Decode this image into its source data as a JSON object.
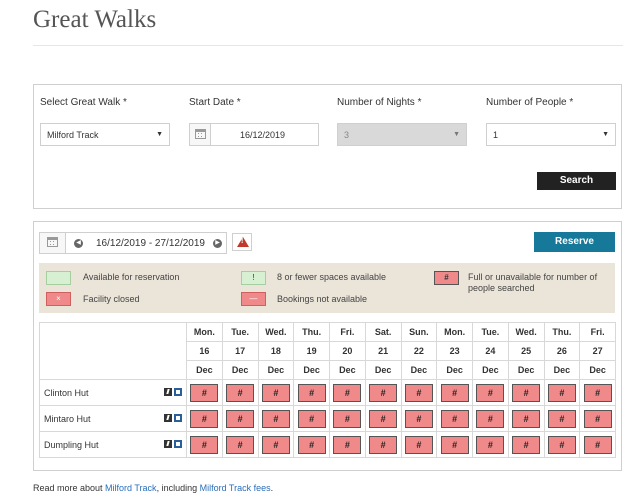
{
  "page": {
    "title": "Great Walks"
  },
  "search": {
    "walk_label": "Select Great Walk *",
    "walk_value": "Milford Track",
    "start_label": "Start Date *",
    "start_value": "16/12/2019",
    "nights_label": "Number of Nights *",
    "nights_value": "3",
    "people_label": "Number of People *",
    "people_value": "1",
    "search_button": "Search"
  },
  "results": {
    "date_range": "16/12/2019 - 27/12/2019",
    "reserve_button": "Reserve",
    "legend": {
      "available": "Available for reservation",
      "few_symbol": "!",
      "few": "8 or fewer spaces available",
      "full_symbol": "#",
      "full_line1": "Full or unavailable for number of",
      "full_line2": "people searched",
      "closed_symbol": "×",
      "closed": "Facility closed",
      "na_symbol": "—",
      "na": "Bookings not available"
    },
    "days": [
      {
        "dow": "Mon.",
        "num": "16",
        "mon": "Dec"
      },
      {
        "dow": "Tue.",
        "num": "17",
        "mon": "Dec"
      },
      {
        "dow": "Wed.",
        "num": "18",
        "mon": "Dec"
      },
      {
        "dow": "Thu.",
        "num": "19",
        "mon": "Dec"
      },
      {
        "dow": "Fri.",
        "num": "20",
        "mon": "Dec"
      },
      {
        "dow": "Sat.",
        "num": "21",
        "mon": "Dec"
      },
      {
        "dow": "Sun.",
        "num": "22",
        "mon": "Dec"
      },
      {
        "dow": "Mon.",
        "num": "23",
        "mon": "Dec"
      },
      {
        "dow": "Tue.",
        "num": "24",
        "mon": "Dec"
      },
      {
        "dow": "Wed.",
        "num": "25",
        "mon": "Dec"
      },
      {
        "dow": "Thu.",
        "num": "26",
        "mon": "Dec"
      },
      {
        "dow": "Fri.",
        "num": "27",
        "mon": "Dec"
      }
    ],
    "huts": [
      {
        "name": "Clinton Hut",
        "cells": [
          "#",
          "#",
          "#",
          "#",
          "#",
          "#",
          "#",
          "#",
          "#",
          "#",
          "#",
          "#"
        ]
      },
      {
        "name": "Mintaro Hut",
        "cells": [
          "#",
          "#",
          "#",
          "#",
          "#",
          "#",
          "#",
          "#",
          "#",
          "#",
          "#",
          "#"
        ]
      },
      {
        "name": "Dumpling Hut",
        "cells": [
          "#",
          "#",
          "#",
          "#",
          "#",
          "#",
          "#",
          "#",
          "#",
          "#",
          "#",
          "#"
        ]
      }
    ]
  },
  "footer": {
    "prefix": "Read more about ",
    "link1": "Milford Track",
    "middle": ", including ",
    "link2": "Milford Track fees",
    "suffix": "."
  }
}
